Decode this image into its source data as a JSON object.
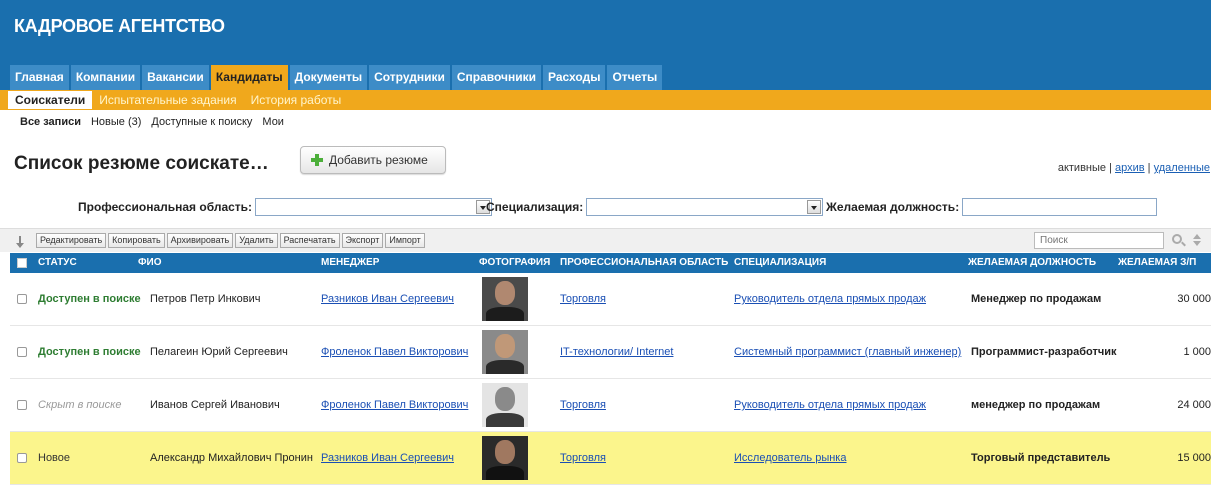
{
  "app": {
    "title": "КАДРОВОЕ АГЕНТСТВО"
  },
  "nav": {
    "tabs": [
      {
        "label": "Главная"
      },
      {
        "label": "Компании"
      },
      {
        "label": "Вакансии"
      },
      {
        "label": "Кандидаты",
        "active": true
      },
      {
        "label": "Документы"
      },
      {
        "label": "Сотрудники"
      },
      {
        "label": "Справочники"
      },
      {
        "label": "Расходы"
      },
      {
        "label": "Отчеты"
      }
    ],
    "subtabs": [
      {
        "label": "Соискатели",
        "active": true
      },
      {
        "label": "Испытательные задания"
      },
      {
        "label": "История работы"
      }
    ],
    "filters": [
      {
        "label": "Все записи",
        "active": true
      },
      {
        "label": "Новые (3)"
      },
      {
        "label": "Доступные к поиску"
      },
      {
        "label": "Мои"
      }
    ]
  },
  "page": {
    "title": "Список резюме соискате…",
    "add_button": "Добавить резюме",
    "view_links": {
      "active": "активные",
      "sep": " | ",
      "archive": "архив",
      "deleted": "удаленные"
    }
  },
  "search": {
    "prof_area_label": "Профессиональная область:",
    "prof_area_value": "",
    "spec_label": "Специализация:",
    "spec_value": "",
    "position_label": "Желаемая должность:",
    "position_value": ""
  },
  "toolbar": {
    "buttons": [
      "Редактировать",
      "Копировать",
      "Архивировать",
      "Удалить",
      "Распечатать",
      "Экспорт",
      "Импорт"
    ],
    "search_placeholder": "Поиск"
  },
  "table": {
    "columns": [
      "СТАТУС",
      "ФИО",
      "МЕНЕДЖЕР",
      "ФОТОГРАФИЯ",
      "ПРОФЕССИОНАЛЬНАЯ ОБЛАСТЬ",
      "СПЕЦИАЛИЗАЦИЯ",
      "ЖЕЛАЕМАЯ ДОЛЖНОСТЬ",
      "ЖЕЛАЕМАЯ З/П"
    ],
    "rows": [
      {
        "status": "Доступен в поиске",
        "status_type": "available",
        "name": "Петров Петр Инкович",
        "manager": "Разников Иван Сергеевич",
        "prof_area": "Торговля",
        "specialization": "Руководитель отдела прямых продаж",
        "position": "Менеджер по продажам",
        "salary": "30 000",
        "highlight": false
      },
      {
        "status": "Доступен в поиске",
        "status_type": "available",
        "name": "Пелагеин Юрий Сергеевич",
        "manager": "Фроленок Павел Викторович",
        "prof_area": "IT-технологии/ Internet",
        "specialization": "Системный программист (главный инженер)",
        "position": "Программист-разработчик",
        "salary": "1 000",
        "highlight": false
      },
      {
        "status": "Скрыт в поиске",
        "status_type": "hidden",
        "name": "Иванов Сергей Иванович",
        "manager": "Фроленок Павел Викторович",
        "prof_area": "Торговля",
        "specialization": "Руководитель отдела прямых продаж",
        "position": "менеджер по продажам",
        "salary": "24 000",
        "highlight": false
      },
      {
        "status": "Новое",
        "status_type": "new",
        "name": "Александр Михайлович Пронин",
        "manager": "Разников Иван Сергеевич",
        "prof_area": "Торговля",
        "specialization": "Исследователь рынка",
        "position": "Торговый представитель",
        "salary": "15 000",
        "highlight": true
      }
    ]
  },
  "colors": {
    "header_blue": "#1a6fae",
    "tab_blue": "#3d8cc7",
    "accent_orange": "#f0a81c",
    "highlight_yellow": "#fbf58c",
    "status_green": "#2e7d32",
    "link_blue": "#1a4fb4"
  }
}
